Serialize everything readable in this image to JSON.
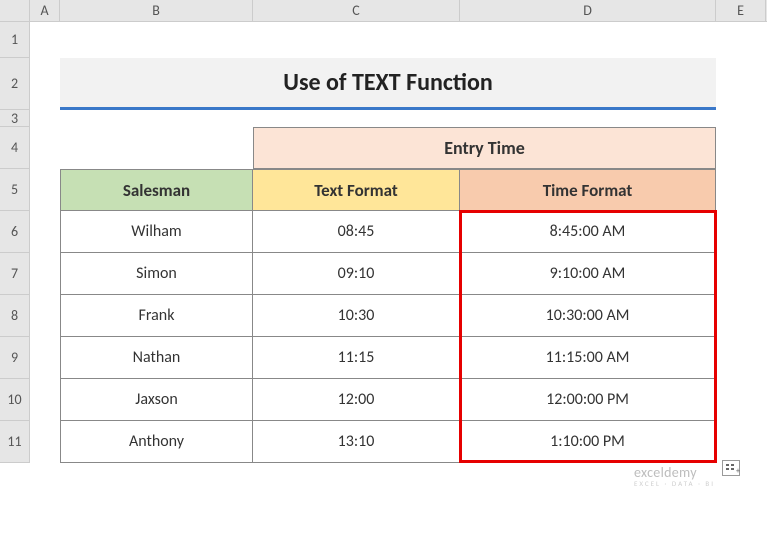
{
  "columns": [
    "A",
    "B",
    "C",
    "D",
    "E"
  ],
  "rows": [
    "1",
    "2",
    "3",
    "4",
    "5",
    "6",
    "7",
    "8",
    "9",
    "10",
    "11"
  ],
  "title": "Use of TEXT Function",
  "headers": {
    "entry_time": "Entry Time",
    "salesman": "Salesman",
    "text_format": "Text Format",
    "time_format": "Time Format"
  },
  "data_rows": [
    {
      "salesman": "Wilham",
      "text": "08:45",
      "time": "8:45:00 AM"
    },
    {
      "salesman": "Simon",
      "text": "09:10",
      "time": "9:10:00 AM"
    },
    {
      "salesman": "Frank",
      "text": "10:30",
      "time": "10:30:00 AM"
    },
    {
      "salesman": "Nathan",
      "text": "11:15",
      "time": "11:15:00 AM"
    },
    {
      "salesman": "Jaxson",
      "text": "12:00",
      "time": "12:00:00 PM"
    },
    {
      "salesman": "Anthony",
      "text": "13:10",
      "time": "1:10:00 PM"
    }
  ],
  "brand": {
    "name": "exceldemy",
    "tagline": "EXCEL · DATA · BI"
  }
}
